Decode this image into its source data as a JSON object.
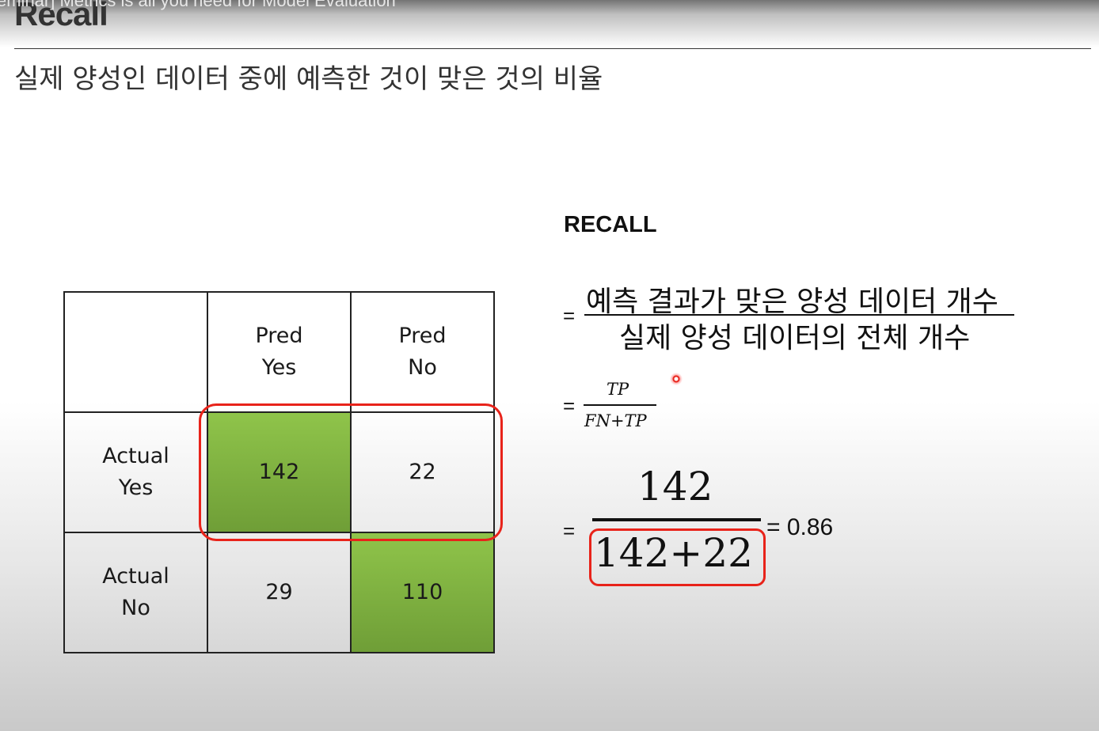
{
  "video_title": "eminar] Metrics is all you need for Model Evaluation",
  "slide": {
    "title": "Recall",
    "subtitle": "실제 양성인 데이터 중에 예측한 것이 맞은 것의 비율"
  },
  "confusion_matrix": {
    "col_headers": [
      "Pred\nYes",
      "Pred\nNo"
    ],
    "row_headers": [
      "Actual\nYes",
      "Actual\nNo"
    ],
    "cells": [
      [
        "142",
        "22"
      ],
      [
        "29",
        "110"
      ]
    ],
    "highlight_color": "#e8231a",
    "green_color": "#7fb342"
  },
  "formula": {
    "label": "RECALL",
    "equals": "=",
    "text_numerator": "예측 결과가 맞은 양성 데이터 개수",
    "text_denominator": "실제 양성 데이터의 전체 개수",
    "symbolic_numerator": "TP",
    "symbolic_denominator": "FN+TP",
    "numeric_numerator": "142",
    "numeric_denominator": "142+22",
    "result": "= 0.86"
  }
}
